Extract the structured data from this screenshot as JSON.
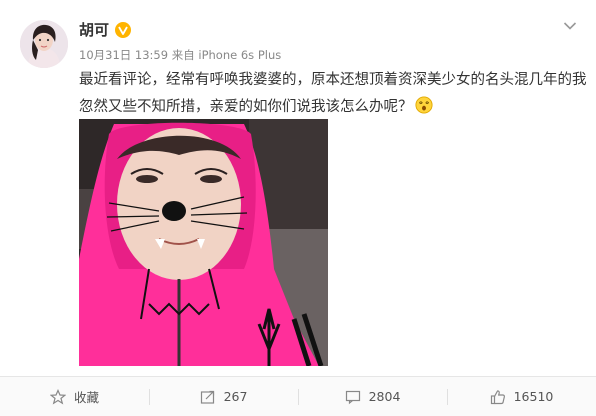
{
  "post": {
    "author": "胡可",
    "time": "10月31日 13:59",
    "source_prefix": "来自",
    "source": "iPhone 6s Plus",
    "text_line1": "最近看评论，经常有呼唤我婆婆的，原本还想顶着资深美少女的名头混几年的我",
    "text_line2": "忽然又些不知所措，亲爱的如你们说我该怎么办呢？"
  },
  "actions": {
    "favorite": "收藏",
    "repost": "267",
    "comment": "2804",
    "like": "16510"
  },
  "colors": {
    "verified_badge": "#ffb400",
    "hoodie": "#ff2f9a",
    "text": "#333333",
    "meta": "#888888"
  },
  "icons": [
    "chevron-down-icon",
    "verified-icon",
    "dizzy-emoji-icon",
    "star-icon",
    "repost-icon",
    "comment-icon",
    "thumbs-up-icon"
  ]
}
